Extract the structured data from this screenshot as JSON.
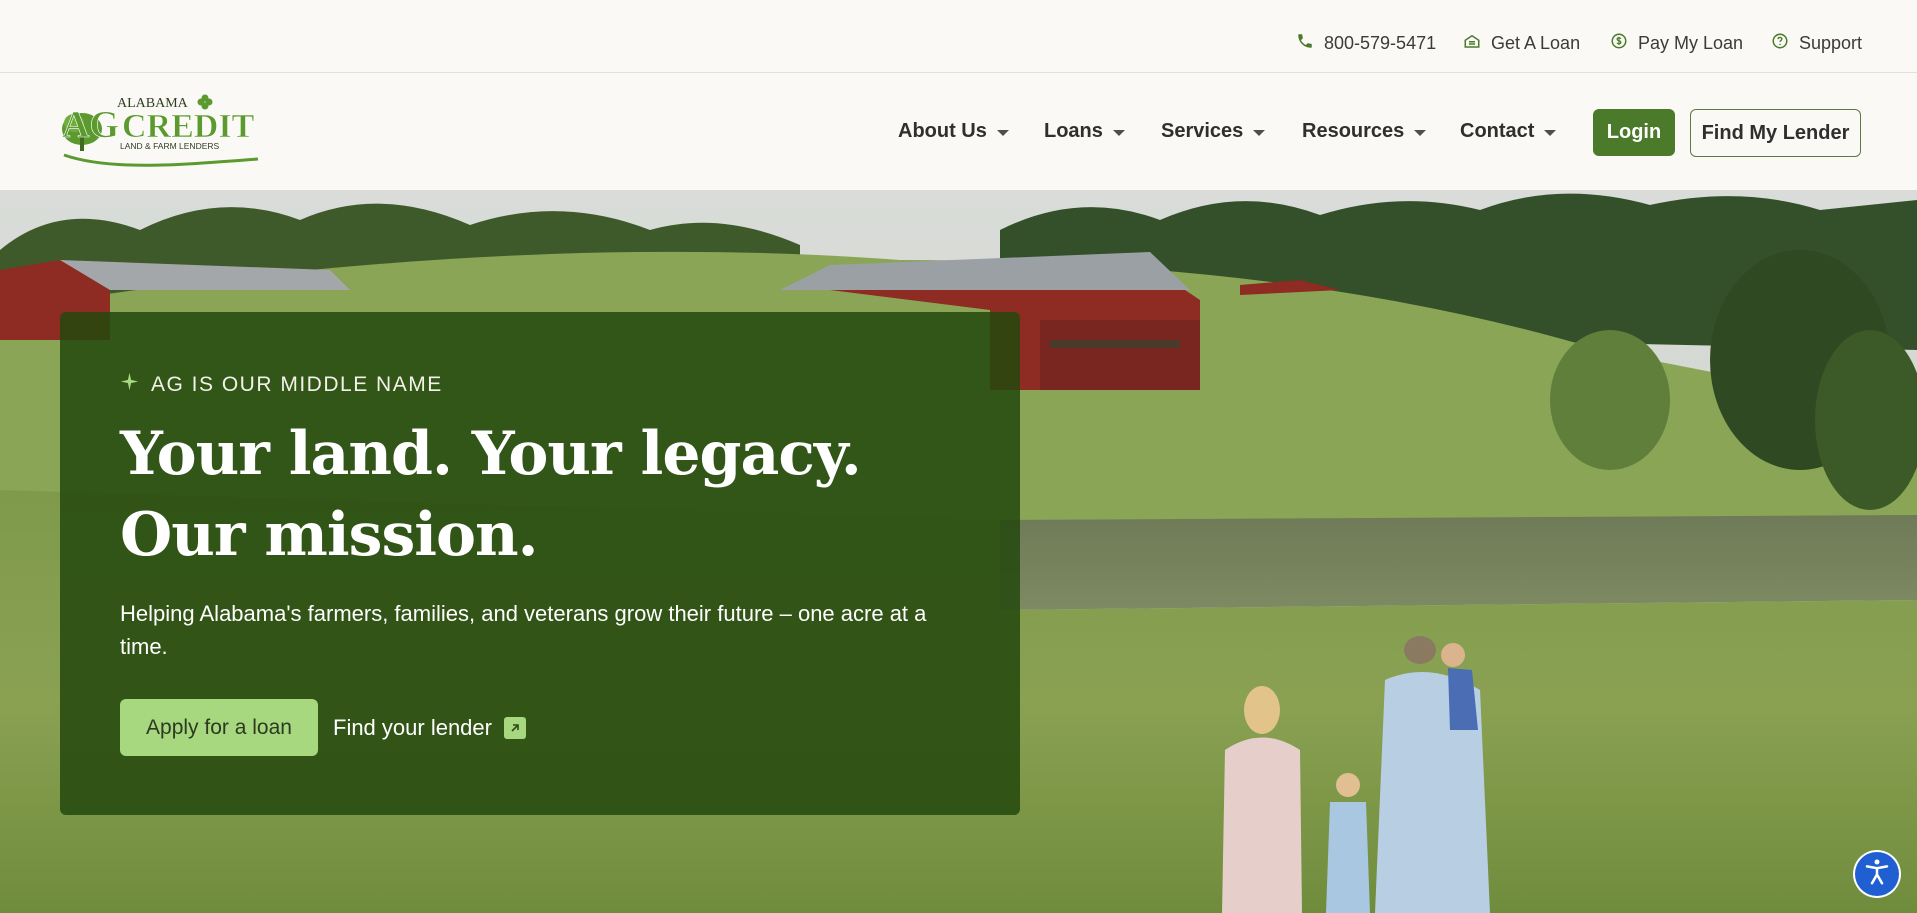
{
  "utility": {
    "phone": "800-579-5471",
    "get_loan": "Get A Loan",
    "pay_loan": "Pay My Loan",
    "support": "Support"
  },
  "logo": {
    "line1": "ALABAMA",
    "line2": "AgCredit",
    "line3": "LAND & FARM LENDERS"
  },
  "nav": {
    "items": [
      {
        "label": "About Us"
      },
      {
        "label": "Loans"
      },
      {
        "label": "Services"
      },
      {
        "label": "Resources"
      },
      {
        "label": "Contact"
      }
    ],
    "login": "Login",
    "find_lender": "Find My Lender"
  },
  "hero": {
    "eyebrow": "AG IS OUR MIDDLE NAME",
    "headline": "Your land. Your legacy. Our mission.",
    "subhead": "Helping Alabama's farmers, families, and veterans grow their future – one acre at a time.",
    "apply_button": "Apply for a loan",
    "find_link": "Find your lender"
  },
  "colors": {
    "brand_green": "#4a7a2a",
    "accent_light_green": "#a7d87f",
    "card_green": "#24480e",
    "page_bg": "#faf9f5",
    "accessibility_blue": "#1f5fd1"
  },
  "icons": [
    "phone-icon",
    "loan-icon",
    "dollar-icon",
    "help-icon",
    "sparkle-icon",
    "external-link-icon",
    "accessibility-icon"
  ]
}
